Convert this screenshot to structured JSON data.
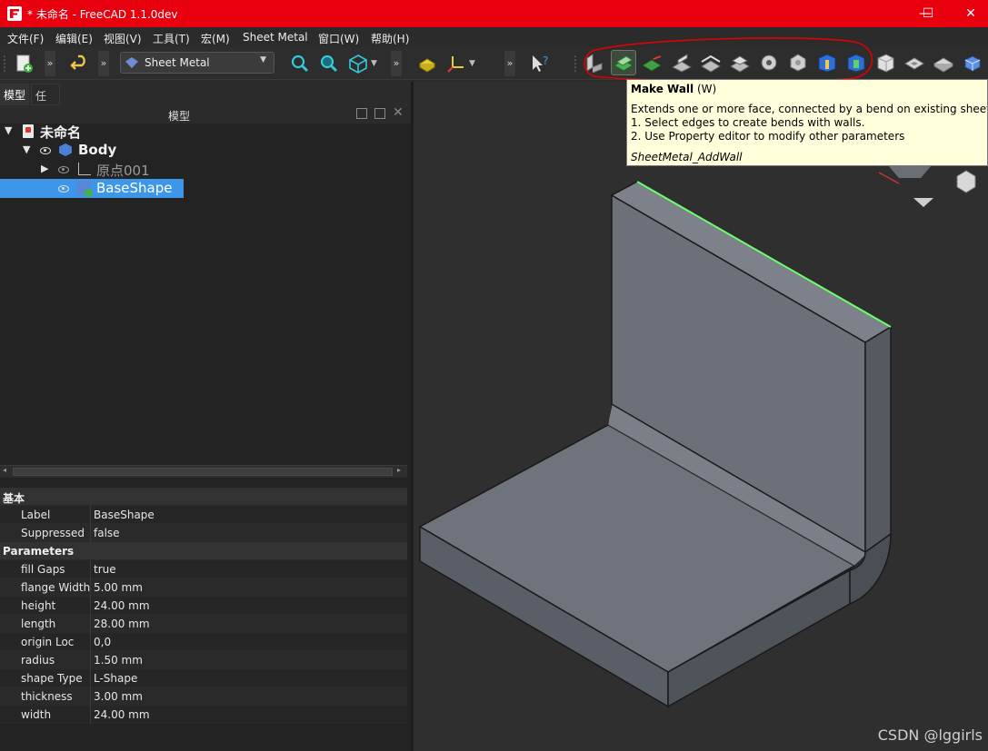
{
  "window": {
    "title": "* 未命名 - FreeCAD 1.1.0dev",
    "minimize": "—",
    "maximize": "☐",
    "close": "✕"
  },
  "menu": [
    "文件(F)",
    "编辑(E)",
    "视图(V)",
    "工具(T)",
    "宏(M)",
    "Sheet Metal",
    "窗口(W)",
    "帮助(H)"
  ],
  "toolbar": {
    "workbench": "Sheet Metal",
    "more": "»"
  },
  "tabs": {
    "model": "模型",
    "tasks": "任务"
  },
  "panel": {
    "title": "模型"
  },
  "tree": {
    "document": "未命名",
    "body": "Body",
    "origin": "原点001",
    "baseshape": "BaseShape"
  },
  "properties": {
    "group_basic": "基本",
    "group_params": "Parameters",
    "rows": [
      {
        "k": "Label",
        "v": "BaseShape"
      },
      {
        "k": "Suppressed",
        "v": "false"
      },
      {
        "k": "fill Gaps",
        "v": "true"
      },
      {
        "k": "flange Width",
        "v": "5.00 mm"
      },
      {
        "k": "height",
        "v": "24.00 mm"
      },
      {
        "k": "length",
        "v": "28.00 mm"
      },
      {
        "k": "origin Loc",
        "v": "0,0"
      },
      {
        "k": "radius",
        "v": "1.50 mm"
      },
      {
        "k": "shape Type",
        "v": "L-Shape"
      },
      {
        "k": "thickness",
        "v": "3.00 mm"
      },
      {
        "k": "width",
        "v": "24.00 mm"
      }
    ]
  },
  "tooltip": {
    "title": "Make Wall",
    "shortcut": "(W)",
    "line1": "Extends one or more face, connected by a bend on existing sheet m",
    "line2": "1. Select edges to create bends with walls.",
    "line3": "2. Use Property editor to modify other parameters",
    "command": "SheetMetal_AddWall"
  },
  "watermark": "CSDN @lggirls",
  "colors": {
    "titlebar": "#e8000f",
    "annotation": "#e00000",
    "selected_edge": "#6cff6c",
    "selection": "#3d96e8"
  }
}
